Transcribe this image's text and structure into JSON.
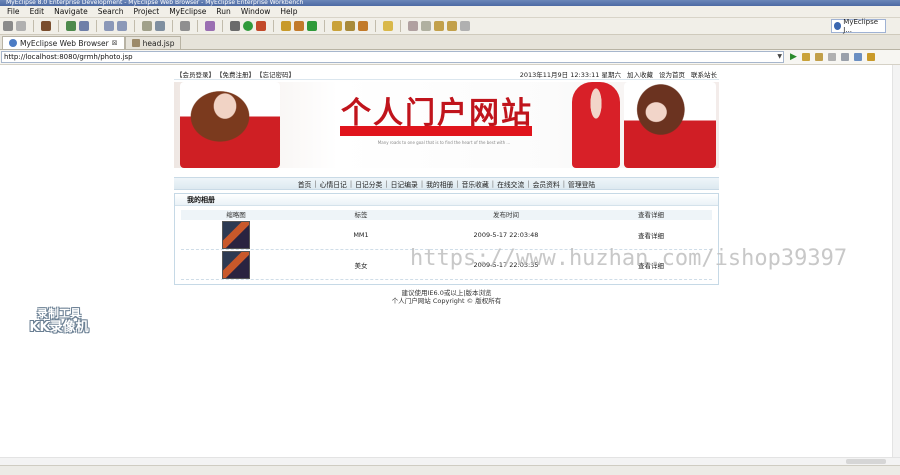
{
  "window": {
    "title": "MyEclipse 8.0 Enterprise Development - MyEclipse Web Browser - MyEclipse Enterprise Workbench"
  },
  "menu": [
    "File",
    "Edit",
    "Navigate",
    "Search",
    "Project",
    "MyEclipse",
    "Run",
    "Window",
    "Help"
  ],
  "perspective": {
    "label": "MyEclipse J..."
  },
  "editor_tabs": [
    {
      "label": "MyEclipse Web Browser",
      "close": "⊠"
    },
    {
      "label": "head.jsp",
      "close": ""
    }
  ],
  "address": {
    "url": "http://localhost:8080/grmh/photo.jsp"
  },
  "site": {
    "top_left_links": [
      "【会员登录】",
      "【免费注册】",
      "【忘记密码】"
    ],
    "date_text": "2013年11月9日 12:33:11  星期六",
    "top_right_links": [
      "加入收藏",
      "设为首页",
      "联系站长"
    ],
    "banner_title": "个人门户网站",
    "banner_small_text": "Many roads to one goal that is to find the heart of the best with ...",
    "nav": [
      "首页",
      "心情日记",
      "日记分类",
      "日记编录",
      "我的相册",
      "音乐收藏",
      "在线交流",
      "会员资料",
      "管理登陆"
    ],
    "panel_title": "我的相册",
    "table": {
      "headers": [
        "缩略图",
        "标签",
        "发布时间",
        "查看详细"
      ],
      "rows": [
        {
          "label": "MM1",
          "time": "2009-5-17 22:03:48",
          "action": "查看详细"
        },
        {
          "label": "美女",
          "time": "2009-5-17 22:03:35",
          "action": "查看详细"
        }
      ]
    },
    "footer_line1": "建议使用IE6.0或以上|版本浏览",
    "footer_line2": "个人门户网站 Copyright © 版权所有"
  },
  "overlays": {
    "watermark": "https://www.huzhan.com/ishop39397",
    "recorder_line1": "录制工具",
    "recorder_line2": "KK录像机"
  },
  "colors": {
    "accent_red": "#c0141c",
    "nav_bg": "#dde9f0"
  }
}
